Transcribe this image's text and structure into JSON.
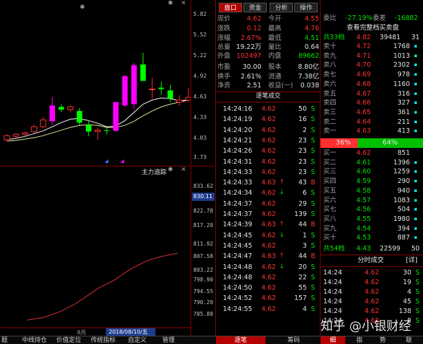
{
  "chart": {
    "close_icon": "✕",
    "menu_icon": "✱",
    "star": "✱",
    "y_ticks": [
      "5.82",
      "5.52",
      "5.22",
      "4.92",
      "4.63",
      "4.33",
      "4.03",
      "3.73"
    ],
    "candles": [
      {
        "o": 4.0,
        "c": 4.06,
        "h": 4.08,
        "l": 3.98,
        "up": true
      },
      {
        "o": 4.05,
        "c": 4.08,
        "h": 4.1,
        "l": 4.03,
        "up": true
      },
      {
        "o": 4.08,
        "c": 4.1,
        "h": 4.12,
        "l": 4.06,
        "up": true
      },
      {
        "o": 4.12,
        "c": 4.19,
        "h": 4.22,
        "l": 4.1,
        "up": true
      },
      {
        "o": 4.19,
        "c": 4.29,
        "h": 4.33,
        "l": 4.17,
        "up": true
      },
      {
        "o": 4.27,
        "c": 4.5,
        "h": 4.62,
        "l": 4.22,
        "up": true
      },
      {
        "o": 4.48,
        "c": 4.44,
        "h": 4.52,
        "l": 4.4,
        "up": false
      },
      {
        "o": 4.44,
        "c": 4.48,
        "h": 4.5,
        "l": 4.4,
        "up": true
      },
      {
        "o": 4.42,
        "c": 4.25,
        "h": 4.46,
        "l": 4.2,
        "up": false
      },
      {
        "o": 4.22,
        "c": 4.12,
        "h": 4.28,
        "l": 4.05,
        "up": false
      },
      {
        "o": 4.12,
        "c": 4.14,
        "h": 4.18,
        "l": 4.0,
        "up": true
      },
      {
        "o": 4.14,
        "c": 4.13,
        "h": 4.18,
        "l": 4.08,
        "up": false
      },
      {
        "o": 4.13,
        "c": 4.55,
        "h": 4.55,
        "l": 4.12,
        "up": true
      },
      {
        "o": 4.5,
        "c": 4.93,
        "h": 4.95,
        "l": 4.48,
        "up": true
      },
      {
        "o": 4.52,
        "c": 5.09,
        "h": 5.12,
        "l": 4.45,
        "up": true
      },
      {
        "o": 5.1,
        "c": 4.86,
        "h": 5.27,
        "l": 4.86,
        "up": false
      },
      {
        "o": 4.73,
        "c": 4.74,
        "h": 4.9,
        "l": 4.6,
        "up": true
      },
      {
        "o": 4.76,
        "c": 4.74,
        "h": 4.85,
        "l": 4.66,
        "up": false
      },
      {
        "o": 4.72,
        "c": 4.6,
        "h": 4.8,
        "l": 4.55,
        "up": false
      },
      {
        "o": 4.55,
        "c": 4.58,
        "h": 4.65,
        "l": 4.5,
        "up": true
      },
      {
        "o": 4.58,
        "c": 4.62,
        "h": 4.75,
        "l": 4.55,
        "up": true
      }
    ],
    "ma1": [
      4.0,
      4.02,
      4.05,
      4.09,
      4.13,
      4.19,
      4.25,
      4.3,
      4.31,
      4.28,
      4.24,
      4.19,
      4.2,
      4.28,
      4.4,
      4.52,
      4.58,
      4.61,
      4.6,
      4.57,
      4.58
    ],
    "ma2": [
      3.98,
      3.99,
      4.01,
      4.03,
      4.06,
      4.1,
      4.14,
      4.18,
      4.21,
      4.22,
      4.21,
      4.18,
      4.18,
      4.21,
      4.27,
      4.35,
      4.42,
      4.48,
      4.52,
      4.55,
      4.58
    ]
  },
  "indicator": {
    "title": "主力追踪",
    "y_ticks": [
      "833.62",
      "830.11",
      "822.78",
      "817.20",
      "811.92",
      "807.58",
      "803.22",
      "798.90",
      "794.55",
      "790.20",
      "785.88"
    ],
    "highlight": "830.11",
    "line": [
      784,
      784.5,
      785,
      786,
      787,
      788.5,
      790,
      792,
      794,
      796,
      797.5,
      799,
      801,
      803,
      804.5,
      806,
      807,
      807.8,
      808.4,
      809
    ],
    "x_labels": [
      "8月",
      "2018/08/10/五"
    ]
  },
  "bottom_bar": {
    "items": [
      "题",
      "中线持仓",
      "价值定位",
      "传统指标",
      "自定义",
      "管理"
    ],
    "right_tabs": [
      "逐笔",
      "筹码",
      "细",
      "指",
      "势",
      "联"
    ]
  },
  "quote": {
    "tabs": [
      "盘口",
      "资金",
      "分析",
      "操作"
    ],
    "rows": [
      {
        "l1": "现价",
        "v1": "4.62",
        "l2": "今开",
        "v2": "4.55",
        "c1": "red",
        "c2": "red"
      },
      {
        "l1": "涨跌",
        "v1": "0.12",
        "l2": "最高",
        "v2": "4.76",
        "c1": "red",
        "c2": "red"
      },
      {
        "l1": "涨幅",
        "v1": "2.67%",
        "l2": "最低",
        "v2": "4.51",
        "c1": "red",
        "c2": "grn"
      },
      {
        "l1": "总量",
        "v1": "19.22万",
        "l2": "量比",
        "v2": "0.64",
        "c1": "wht",
        "c2": "wht"
      },
      {
        "l1": "外盘",
        "v1": "102497",
        "l2": "内盘",
        "v2": "89662",
        "c1": "red",
        "c2": "grn"
      },
      {
        "l1": "市盈",
        "v1": "30.00",
        "l2": "股本",
        "v2": "8.80亿",
        "c1": "wht",
        "c2": "wht"
      },
      {
        "l1": "换手",
        "v1": "2.61%",
        "l2": "流通",
        "v2": "7.38亿",
        "c1": "wht",
        "c2": "wht"
      },
      {
        "l1": "净资",
        "v1": "2.51",
        "l2": "收益(一)",
        "v2": "0.038",
        "c1": "wht",
        "c2": "wht"
      }
    ],
    "trades_title": "逐笔成交",
    "trades": [
      {
        "t": "14:24:16",
        "p": "4.62",
        "v": "50",
        "d": "S",
        "a": "",
        "c": "grn"
      },
      {
        "t": "14:24:19",
        "p": "4.62",
        "v": "16",
        "d": "S",
        "a": "",
        "c": "grn"
      },
      {
        "t": "14:24:20",
        "p": "4.62",
        "v": "2",
        "d": "S",
        "a": "",
        "c": "grn"
      },
      {
        "t": "14:24:21",
        "p": "4.62",
        "v": "23",
        "d": "S",
        "a": "",
        "c": "grn"
      },
      {
        "t": "14:24:26",
        "p": "4.62",
        "v": "23",
        "d": "S",
        "a": "",
        "c": "grn"
      },
      {
        "t": "14:24:31",
        "p": "4.62",
        "v": "23",
        "d": "S",
        "a": "",
        "c": "grn"
      },
      {
        "t": "14:24:33",
        "p": "4.62",
        "v": "23",
        "d": "S",
        "a": "",
        "c": "grn"
      },
      {
        "t": "14:24:33",
        "p": "4.63",
        "v": "43",
        "d": "B",
        "a": "↑",
        "c": "red"
      },
      {
        "t": "14:24:34",
        "p": "4.62",
        "v": "6",
        "d": "S",
        "a": "↓",
        "c": "grn"
      },
      {
        "t": "14:24:37",
        "p": "4.62",
        "v": "29",
        "d": "S",
        "a": "",
        "c": "grn"
      },
      {
        "t": "14:24:37",
        "p": "4.62",
        "v": "139",
        "d": "S",
        "a": "",
        "c": "grn"
      },
      {
        "t": "14:24:39",
        "p": "4.63",
        "v": "44",
        "d": "B",
        "a": "↑",
        "c": "red"
      },
      {
        "t": "14:24:45",
        "p": "4.62",
        "v": "1",
        "d": "S",
        "a": "↓",
        "c": "grn"
      },
      {
        "t": "14:24:45",
        "p": "4.62",
        "v": "3",
        "d": "S",
        "a": "",
        "c": "grn"
      },
      {
        "t": "14:24:47",
        "p": "4.63",
        "v": "44",
        "d": "B",
        "a": "↑",
        "c": "red"
      },
      {
        "t": "14:24:48",
        "p": "4.62",
        "v": "20",
        "d": "S",
        "a": "↓",
        "c": "grn"
      },
      {
        "t": "14:24:48",
        "p": "4.62",
        "v": "22",
        "d": "S",
        "a": "",
        "c": "grn"
      },
      {
        "t": "14:24:50",
        "p": "4.62",
        "v": "55",
        "d": "S",
        "a": "",
        "c": "grn"
      },
      {
        "t": "14:24:52",
        "p": "4.62",
        "v": "157",
        "d": "S",
        "a": "",
        "c": "grn"
      },
      {
        "t": "14:24:55",
        "p": "4.62",
        "v": "4",
        "d": "S",
        "a": "",
        "c": "grn"
      }
    ]
  },
  "orderbook": {
    "weibi_label": "委比",
    "weibi": "-27.19%",
    "weicha_label": "委差",
    "weicha": "-16882",
    "link": "查看完整档买卖盘",
    "sell_total_label": "共33档",
    "sell_total_price": "4.82",
    "sell_total_vol": "39481",
    "sell_total_n": "31",
    "sells": [
      {
        "l": "卖十",
        "p": "4.72",
        "v": "1768",
        "m": "▪"
      },
      {
        "l": "卖九",
        "p": "4.71",
        "v": "1013",
        "m": "▪"
      },
      {
        "l": "卖八",
        "p": "4.70",
        "v": "2302",
        "m": "▪"
      },
      {
        "l": "卖七",
        "p": "4.69",
        "v": "978",
        "m": "▪"
      },
      {
        "l": "卖六",
        "p": "4.68",
        "v": "1160",
        "m": "▪"
      },
      {
        "l": "卖五",
        "p": "4.67",
        "v": "316",
        "m": "▪"
      },
      {
        "l": "卖四",
        "p": "4.66",
        "v": "327",
        "m": "▪"
      },
      {
        "l": "卖三",
        "p": "4.65",
        "v": "361",
        "m": "▪"
      },
      {
        "l": "卖二",
        "p": "4.64",
        "v": "211",
        "m": "▪"
      },
      {
        "l": "卖一",
        "p": "4.63",
        "v": "413",
        "m": "▪"
      }
    ],
    "ratio_left": "36%",
    "ratio_right": "64%",
    "ratio_fraction": 0.36,
    "buys": [
      {
        "l": "买一",
        "p": "4.62",
        "v": "851",
        "m": ""
      },
      {
        "l": "买二",
        "p": "4.61",
        "v": "1396",
        "m": "▪"
      },
      {
        "l": "买三",
        "p": "4.60",
        "v": "1259",
        "m": "▪"
      },
      {
        "l": "买四",
        "p": "4.59",
        "v": "290",
        "m": "▪"
      },
      {
        "l": "买五",
        "p": "4.58",
        "v": "940",
        "m": "▪"
      },
      {
        "l": "买六",
        "p": "4.57",
        "v": "1083",
        "m": "▪"
      },
      {
        "l": "买七",
        "p": "4.56",
        "v": "504",
        "m": "▪"
      },
      {
        "l": "买八",
        "p": "4.55",
        "v": "1980",
        "m": "▪"
      },
      {
        "l": "买九",
        "p": "4.54",
        "v": "394",
        "m": "▪"
      },
      {
        "l": "买十",
        "p": "4.53",
        "v": "887",
        "m": "▪"
      }
    ],
    "buy_total_label": "共54档",
    "buy_total_price": "4.43",
    "buy_total_vol": "22599",
    "buy_total_n": "50",
    "fenshi_title": "分时成交",
    "detail_btn": "[详]",
    "fenshi": [
      {
        "t": "14:24",
        "p": "4.62",
        "v": "30",
        "d": "S"
      },
      {
        "t": "14:24",
        "p": "4.62",
        "v": "19",
        "d": "S"
      },
      {
        "t": "14:24",
        "p": "4.62",
        "v": "4",
        "d": "S"
      },
      {
        "t": "14:24",
        "p": "4.62",
        "v": "45",
        "d": "S"
      },
      {
        "t": "14:24",
        "p": "4.62",
        "v": "138",
        "d": "S"
      },
      {
        "t": "14:24",
        "p": "4.62",
        "v": "8",
        "d": "S"
      }
    ]
  },
  "watermark": "知乎 @小银财经"
}
